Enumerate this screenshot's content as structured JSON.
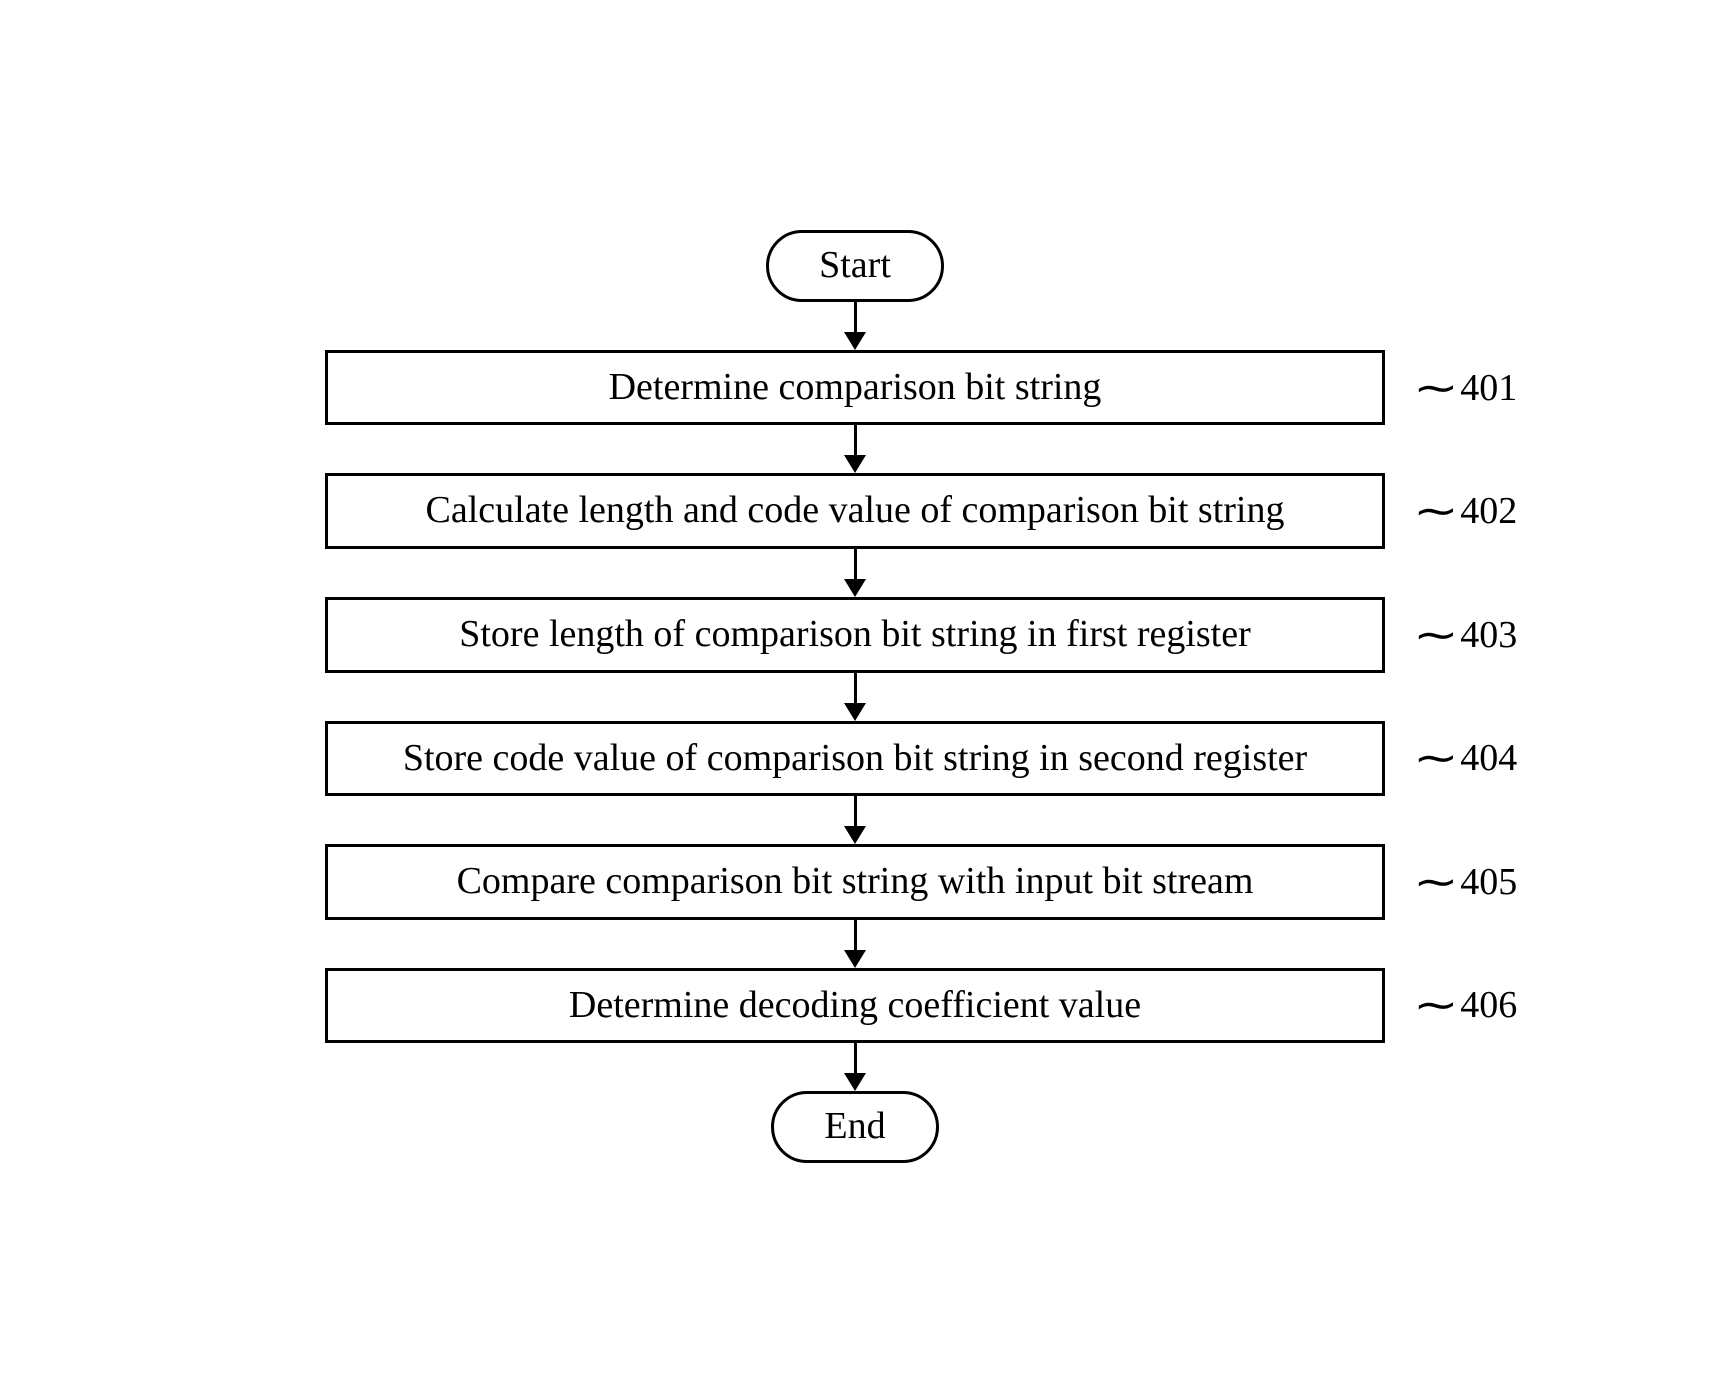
{
  "terminals": {
    "start": "Start",
    "end": "End"
  },
  "steps": [
    {
      "label": "Determine comparison bit string",
      "ref": "401"
    },
    {
      "label": "Calculate length and code value of comparison bit string",
      "ref": "402"
    },
    {
      "label": "Store length of comparison bit string in first register",
      "ref": "403"
    },
    {
      "label": "Store code value of comparison bit string in second register",
      "ref": "404"
    },
    {
      "label": "Compare comparison bit string with input bit stream",
      "ref": "405"
    },
    {
      "label": "Determine decoding coefficient value",
      "ref": "406"
    }
  ]
}
